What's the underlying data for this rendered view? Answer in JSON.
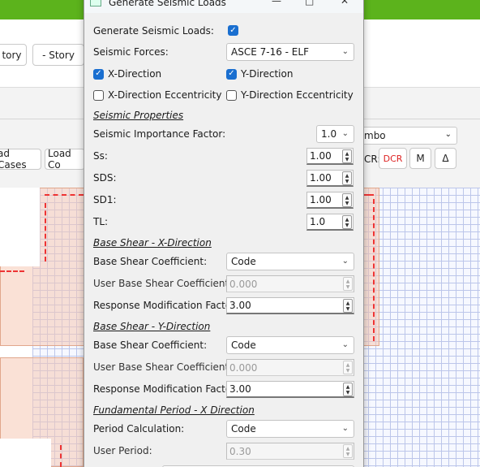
{
  "background": {
    "toolbar": {
      "story_btn": "tory",
      "minus_story_btn": "- Story"
    },
    "tabs": {
      "load_cases": "ad Cases",
      "load_combos": "Load Co"
    },
    "combo_select": "mbo",
    "results": {
      "prefix": "CR:",
      "dcr": "DCR",
      "m": "M",
      "delta": "Δ"
    }
  },
  "dialog": {
    "title": "Generate Seismic Loads",
    "generate_label": "Generate Seismic Loads:",
    "generate_checked": true,
    "seismic_forces_label": "Seismic Forces:",
    "seismic_forces_value": "ASCE 7-16 - ELF",
    "x_direction": {
      "label": "X-Direction",
      "checked": true
    },
    "y_direction": {
      "label": "Y-Direction",
      "checked": true
    },
    "x_ecc": {
      "label": "X-Direction Eccentricity",
      "checked": false
    },
    "y_ecc": {
      "label": "Y-Direction Eccentricity",
      "checked": false
    },
    "seismic_properties": {
      "heading": "Seismic Properties",
      "importance_label": "Seismic Importance Factor:",
      "importance_value": "1.0",
      "ss_label": "Ss:",
      "ss_value": "1.00",
      "sds_label": "SDS:",
      "sds_value": "1.00",
      "sd1_label": "SD1:",
      "sd1_value": "1.00",
      "tl_label": "TL:",
      "tl_value": "1.0"
    },
    "base_shear_x": {
      "heading": "Base Shear - X-Direction",
      "coef_label": "Base Shear Coefficient:",
      "coef_value": "Code",
      "user_label": "User Base Shear Coefficient:",
      "user_value": "0.000",
      "rmf_label": "Response Modification Factor:",
      "rmf_value": "3.00"
    },
    "base_shear_y": {
      "heading": "Base Shear - Y-Direction",
      "coef_label": "Base Shear Coefficient:",
      "coef_value": "Code",
      "user_label": "User Base Shear Coefficient:",
      "user_value": "0.000",
      "rmf_label": "Response Modification Factor:",
      "rmf_value": "3.00"
    },
    "period_x": {
      "heading": "Fundamental Period - X Direction",
      "calc_label": "Period Calculation:",
      "calc_value": "Code",
      "user_label": "User Period:",
      "user_value": "0.30"
    }
  }
}
